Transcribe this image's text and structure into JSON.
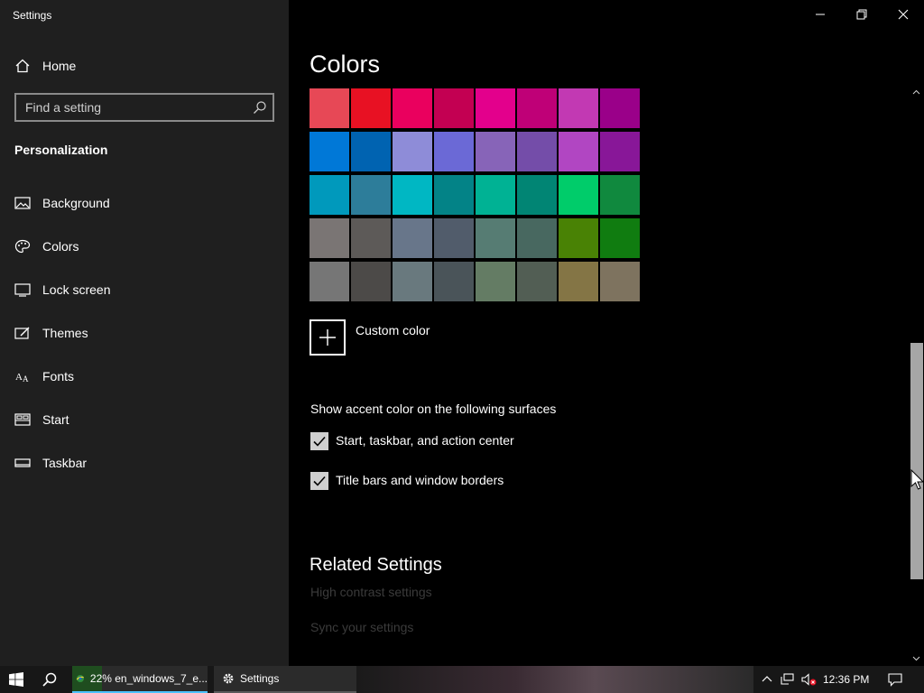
{
  "window": {
    "title": "Settings"
  },
  "sidebar": {
    "home_label": "Home",
    "search_placeholder": "Find a setting",
    "section_label": "Personalization",
    "items": [
      {
        "label": "Background",
        "icon": "picture-icon"
      },
      {
        "label": "Colors",
        "icon": "palette-icon",
        "selected": true
      },
      {
        "label": "Lock screen",
        "icon": "lock-screen-icon"
      },
      {
        "label": "Themes",
        "icon": "themes-icon"
      },
      {
        "label": "Fonts",
        "icon": "fonts-icon"
      },
      {
        "label": "Start",
        "icon": "start-icon"
      },
      {
        "label": "Taskbar",
        "icon": "taskbar-icon"
      }
    ]
  },
  "main": {
    "title": "Colors",
    "swatch_rows": [
      [
        "#e74856",
        "#e81123",
        "#ea005e",
        "#c30052",
        "#e3008c",
        "#bf0077",
        "#c239b3",
        "#9a0089"
      ],
      [
        "#0078d7",
        "#0063b1",
        "#8e8cd8",
        "#6b69d6",
        "#8764b8",
        "#744da9",
        "#b146c2",
        "#881798"
      ],
      [
        "#0099bc",
        "#2d7d9a",
        "#00b7c3",
        "#038387",
        "#00b294",
        "#018574",
        "#00cc6a",
        "#10893e"
      ],
      [
        "#7a7574",
        "#5d5a58",
        "#68768a",
        "#515c6b",
        "#567c73",
        "#486860",
        "#498205",
        "#107c10"
      ],
      [
        "#767676",
        "#4c4a48",
        "#69797e",
        "#4a5459",
        "#647c64",
        "#525e54",
        "#847545",
        "#7e735f"
      ]
    ],
    "custom_color_label": "Custom color",
    "surfaces_label": "Show accent color on the following surfaces",
    "checkboxes": [
      {
        "label": "Start, taskbar, and action center",
        "checked": true
      },
      {
        "label": "Title bars and window borders",
        "checked": true
      }
    ],
    "related_title": "Related Settings",
    "related_links": [
      "High contrast settings",
      "Sync your settings"
    ]
  },
  "taskbar": {
    "task1_label": "22% en_windows_7_e...",
    "task1_progress": 0.22,
    "task2_label": "Settings",
    "clock": "12:36 PM"
  },
  "colors": {
    "sidebar_bg": "#1f1f1f",
    "main_bg": "#000000",
    "taskbar_bg": "#171717",
    "progress": "#1f4d1f"
  }
}
